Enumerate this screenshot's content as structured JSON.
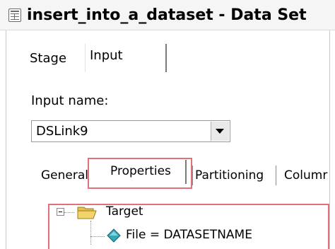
{
  "window": {
    "title": "insert_into_a_dataset - Data Set",
    "icon": "dataset-stage-icon"
  },
  "main_tabs": [
    {
      "label": "Stage",
      "active": false
    },
    {
      "label": "Input",
      "active": true
    }
  ],
  "input_name": {
    "label": "Input name:",
    "selected": "DSLink9"
  },
  "sub_tabs": [
    {
      "label": "General",
      "active": false
    },
    {
      "label": "Properties",
      "active": true
    },
    {
      "label": "Partitioning",
      "active": false
    },
    {
      "label": "Columr",
      "active": false
    }
  ],
  "tree": {
    "root": {
      "label": "Target",
      "icon": "folder-open-icon",
      "expanded": true
    },
    "child": {
      "label": "File = DATASETNAME",
      "icon": "property-diamond-icon"
    }
  },
  "colors": {
    "highlight": "#e0707a",
    "folder": "#f3d46a",
    "diamond": "#35a7b8"
  }
}
